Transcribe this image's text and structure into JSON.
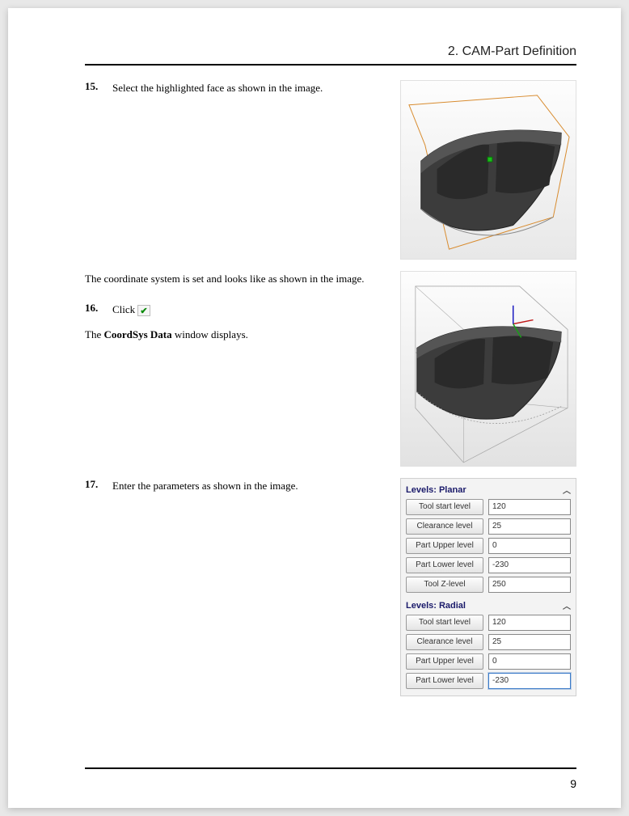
{
  "header": {
    "title": "2. CAM-Part Definition"
  },
  "steps": {
    "s15": {
      "num": "15.",
      "text": "Select the highlighted face as shown in the image."
    },
    "coord_text": "The coordinate system is set and looks like as shown in the image.",
    "s16": {
      "num": "16.",
      "text": "Click"
    },
    "coordsys_line_prefix": "The ",
    "coordsys_bold": "CoordSys Data",
    "coordsys_line_suffix": " window displays.",
    "s17": {
      "num": "17.",
      "text": "Enter the parameters as shown in the image."
    }
  },
  "levels": {
    "planar": {
      "title": "Levels: Planar",
      "rows": [
        {
          "label": "Tool start level",
          "value": "120"
        },
        {
          "label": "Clearance level",
          "value": "25"
        },
        {
          "label": "Part Upper level",
          "value": "0"
        },
        {
          "label": "Part Lower level",
          "value": "-230"
        },
        {
          "label": "Tool Z-level",
          "value": "250"
        }
      ]
    },
    "radial": {
      "title": "Levels: Radial",
      "rows": [
        {
          "label": "Tool start level",
          "value": "120"
        },
        {
          "label": "Clearance level",
          "value": "25"
        },
        {
          "label": "Part Upper level",
          "value": "0"
        },
        {
          "label": "Part Lower level",
          "value": "-230"
        }
      ]
    }
  },
  "page_number": "9"
}
